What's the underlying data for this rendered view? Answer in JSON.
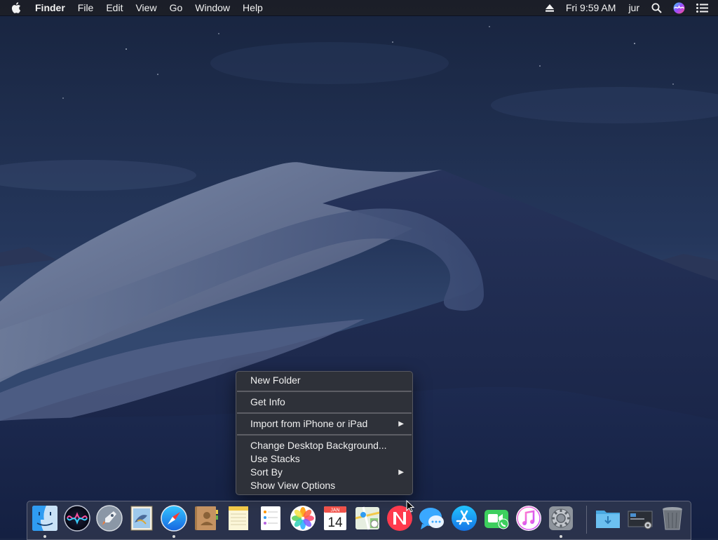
{
  "menubar": {
    "apple_icon": "apple-logo-icon",
    "app_name": "Finder",
    "menus": [
      "File",
      "Edit",
      "View",
      "Go",
      "Window",
      "Help"
    ],
    "status": {
      "eject_icon": "eject-icon",
      "clock": "Fri 9:59 AM",
      "user": "jur",
      "search_icon": "spotlight-search-icon",
      "siri_icon": "siri-icon",
      "notifications_icon": "notification-center-icon"
    }
  },
  "context_menu": {
    "new_folder": "New Folder",
    "get_info": "Get Info",
    "import": "Import from iPhone or iPad",
    "change_background": "Change Desktop Background...",
    "use_stacks": "Use Stacks",
    "sort_by": "Sort By",
    "show_view_options": "Show View Options",
    "submenu_arrow": "▶"
  },
  "dock": {
    "apps": [
      {
        "name": "Finder",
        "icon": "finder-icon",
        "running": true
      },
      {
        "name": "Siri",
        "icon": "siri-icon",
        "running": false
      },
      {
        "name": "Launchpad",
        "icon": "launchpad-icon",
        "running": false
      },
      {
        "name": "Mail",
        "icon": "mail-icon",
        "running": false
      },
      {
        "name": "Safari",
        "icon": "safari-icon",
        "running": true
      },
      {
        "name": "Contacts",
        "icon": "contacts-icon",
        "running": false
      },
      {
        "name": "Notes",
        "icon": "notes-icon",
        "running": false
      },
      {
        "name": "Reminders",
        "icon": "reminders-icon",
        "running": false
      },
      {
        "name": "Photos",
        "icon": "photos-icon",
        "running": false
      },
      {
        "name": "Calendar",
        "icon": "calendar-icon",
        "running": false
      },
      {
        "name": "Maps",
        "icon": "maps-icon",
        "running": false
      },
      {
        "name": "News",
        "icon": "news-icon",
        "running": false
      },
      {
        "name": "Messages",
        "icon": "messages-icon",
        "running": false
      },
      {
        "name": "App Store",
        "icon": "app-store-icon",
        "running": false
      },
      {
        "name": "FaceTime",
        "icon": "facetime-icon",
        "running": false
      },
      {
        "name": "iTunes",
        "icon": "itunes-icon",
        "running": false
      },
      {
        "name": "System Preferences",
        "icon": "system-preferences-icon",
        "running": true
      }
    ],
    "calendar_month": "JAN",
    "calendar_day": "14",
    "extras": [
      {
        "name": "Downloads",
        "icon": "downloads-folder-icon"
      },
      {
        "name": "Screenshot",
        "icon": "screenshot-stack-icon"
      },
      {
        "name": "Trash",
        "icon": "trash-icon"
      }
    ]
  },
  "colors": {
    "sky_top": "#1a2744",
    "sky_bottom": "#2e4470",
    "dune_light": "#6f7d9c",
    "dune_dark": "#1a2548",
    "menu_bg": "#303238",
    "accent": "#1e90ff"
  }
}
